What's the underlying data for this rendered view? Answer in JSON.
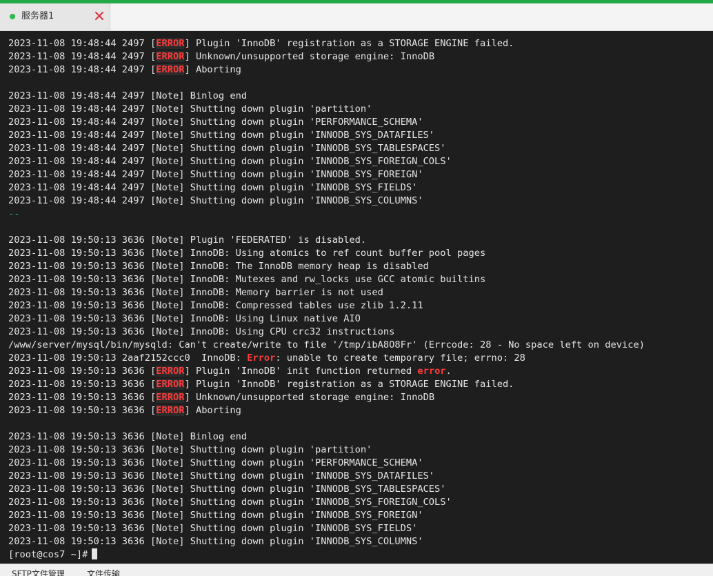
{
  "colors": {
    "accent": "#22a847",
    "status_dot": "#2dbb4e",
    "close": "#e0313a",
    "terminal_bg": "#1e1e1e",
    "terminal_fg": "#e6e6e6",
    "error": "#ff3b3b",
    "separator": "#3fa5c9"
  },
  "tab": {
    "label": "服务器1",
    "status_icon": "green-dot-icon",
    "close_icon": "close-icon"
  },
  "terminal": {
    "lines": [
      [
        {
          "t": "2023-11-08 19:48:44 2497 ["
        },
        {
          "t": "ERROR",
          "s": "err-tag"
        },
        {
          "t": "] Plugin 'InnoDB' registration as a STORAGE ENGINE failed."
        }
      ],
      [
        {
          "t": "2023-11-08 19:48:44 2497 ["
        },
        {
          "t": "ERROR",
          "s": "err-tag"
        },
        {
          "t": "] Unknown/unsupported storage engine: InnoDB"
        }
      ],
      [
        {
          "t": "2023-11-08 19:48:44 2497 ["
        },
        {
          "t": "ERROR",
          "s": "err-tag"
        },
        {
          "t": "] Aborting"
        }
      ],
      [
        {
          "t": ""
        }
      ],
      [
        {
          "t": "2023-11-08 19:48:44 2497 [Note] Binlog end"
        }
      ],
      [
        {
          "t": "2023-11-08 19:48:44 2497 [Note] Shutting down plugin 'partition'"
        }
      ],
      [
        {
          "t": "2023-11-08 19:48:44 2497 [Note] Shutting down plugin 'PERFORMANCE_SCHEMA'"
        }
      ],
      [
        {
          "t": "2023-11-08 19:48:44 2497 [Note] Shutting down plugin 'INNODB_SYS_DATAFILES'"
        }
      ],
      [
        {
          "t": "2023-11-08 19:48:44 2497 [Note] Shutting down plugin 'INNODB_SYS_TABLESPACES'"
        }
      ],
      [
        {
          "t": "2023-11-08 19:48:44 2497 [Note] Shutting down plugin 'INNODB_SYS_FOREIGN_COLS'"
        }
      ],
      [
        {
          "t": "2023-11-08 19:48:44 2497 [Note] Shutting down plugin 'INNODB_SYS_FOREIGN'"
        }
      ],
      [
        {
          "t": "2023-11-08 19:48:44 2497 [Note] Shutting down plugin 'INNODB_SYS_FIELDS'"
        }
      ],
      [
        {
          "t": "2023-11-08 19:48:44 2497 [Note] Shutting down plugin 'INNODB_SYS_COLUMNS'"
        }
      ],
      [
        {
          "t": "--",
          "s": "sep"
        }
      ],
      [
        {
          "t": ""
        }
      ],
      [
        {
          "t": "2023-11-08 19:50:13 3636 [Note] Plugin 'FEDERATED' is disabled."
        }
      ],
      [
        {
          "t": "2023-11-08 19:50:13 3636 [Note] InnoDB: Using atomics to ref count buffer pool pages"
        }
      ],
      [
        {
          "t": "2023-11-08 19:50:13 3636 [Note] InnoDB: The InnoDB memory heap is disabled"
        }
      ],
      [
        {
          "t": "2023-11-08 19:50:13 3636 [Note] InnoDB: Mutexes and rw_locks use GCC atomic builtins"
        }
      ],
      [
        {
          "t": "2023-11-08 19:50:13 3636 [Note] InnoDB: Memory barrier is not used"
        }
      ],
      [
        {
          "t": "2023-11-08 19:50:13 3636 [Note] InnoDB: Compressed tables use zlib 1.2.11"
        }
      ],
      [
        {
          "t": "2023-11-08 19:50:13 3636 [Note] InnoDB: Using Linux native AIO"
        }
      ],
      [
        {
          "t": "2023-11-08 19:50:13 3636 [Note] InnoDB: Using CPU crc32 instructions"
        }
      ],
      [
        {
          "t": "/www/server/mysql/bin/mysqld: Can't create/write to file '/tmp/ibA8O8Fr' (Errcode: 28 - No space left on device)"
        }
      ],
      [
        {
          "t": "2023-11-08 19:50:13 2aaf2152ccc0  InnoDB: "
        },
        {
          "t": "Error",
          "s": "err-word"
        },
        {
          "t": ": unable to create temporary file; errno: 28"
        }
      ],
      [
        {
          "t": "2023-11-08 19:50:13 3636 ["
        },
        {
          "t": "ERROR",
          "s": "err-tag"
        },
        {
          "t": "] Plugin 'InnoDB' init function returned "
        },
        {
          "t": "error",
          "s": "err-word"
        },
        {
          "t": "."
        }
      ],
      [
        {
          "t": "2023-11-08 19:50:13 3636 ["
        },
        {
          "t": "ERROR",
          "s": "err-tag"
        },
        {
          "t": "] Plugin 'InnoDB' registration as a STORAGE ENGINE failed."
        }
      ],
      [
        {
          "t": "2023-11-08 19:50:13 3636 ["
        },
        {
          "t": "ERROR",
          "s": "err-tag"
        },
        {
          "t": "] Unknown/unsupported storage engine: InnoDB"
        }
      ],
      [
        {
          "t": "2023-11-08 19:50:13 3636 ["
        },
        {
          "t": "ERROR",
          "s": "err-tag"
        },
        {
          "t": "] Aborting"
        }
      ],
      [
        {
          "t": ""
        }
      ],
      [
        {
          "t": "2023-11-08 19:50:13 3636 [Note] Binlog end"
        }
      ],
      [
        {
          "t": "2023-11-08 19:50:13 3636 [Note] Shutting down plugin 'partition'"
        }
      ],
      [
        {
          "t": "2023-11-08 19:50:13 3636 [Note] Shutting down plugin 'PERFORMANCE_SCHEMA'"
        }
      ],
      [
        {
          "t": "2023-11-08 19:50:13 3636 [Note] Shutting down plugin 'INNODB_SYS_DATAFILES'"
        }
      ],
      [
        {
          "t": "2023-11-08 19:50:13 3636 [Note] Shutting down plugin 'INNODB_SYS_TABLESPACES'"
        }
      ],
      [
        {
          "t": "2023-11-08 19:50:13 3636 [Note] Shutting down plugin 'INNODB_SYS_FOREIGN_COLS'"
        }
      ],
      [
        {
          "t": "2023-11-08 19:50:13 3636 [Note] Shutting down plugin 'INNODB_SYS_FOREIGN'"
        }
      ],
      [
        {
          "t": "2023-11-08 19:50:13 3636 [Note] Shutting down plugin 'INNODB_SYS_FIELDS'"
        }
      ],
      [
        {
          "t": "2023-11-08 19:50:13 3636 [Note] Shutting down plugin 'INNODB_SYS_COLUMNS'"
        }
      ]
    ],
    "prompt": "[root@cos7 ~]#",
    "cursor_icon": "block-cursor-icon"
  },
  "bottom_tabs": [
    {
      "label": "SFTP文件管理"
    },
    {
      "label": "文件传输"
    }
  ]
}
